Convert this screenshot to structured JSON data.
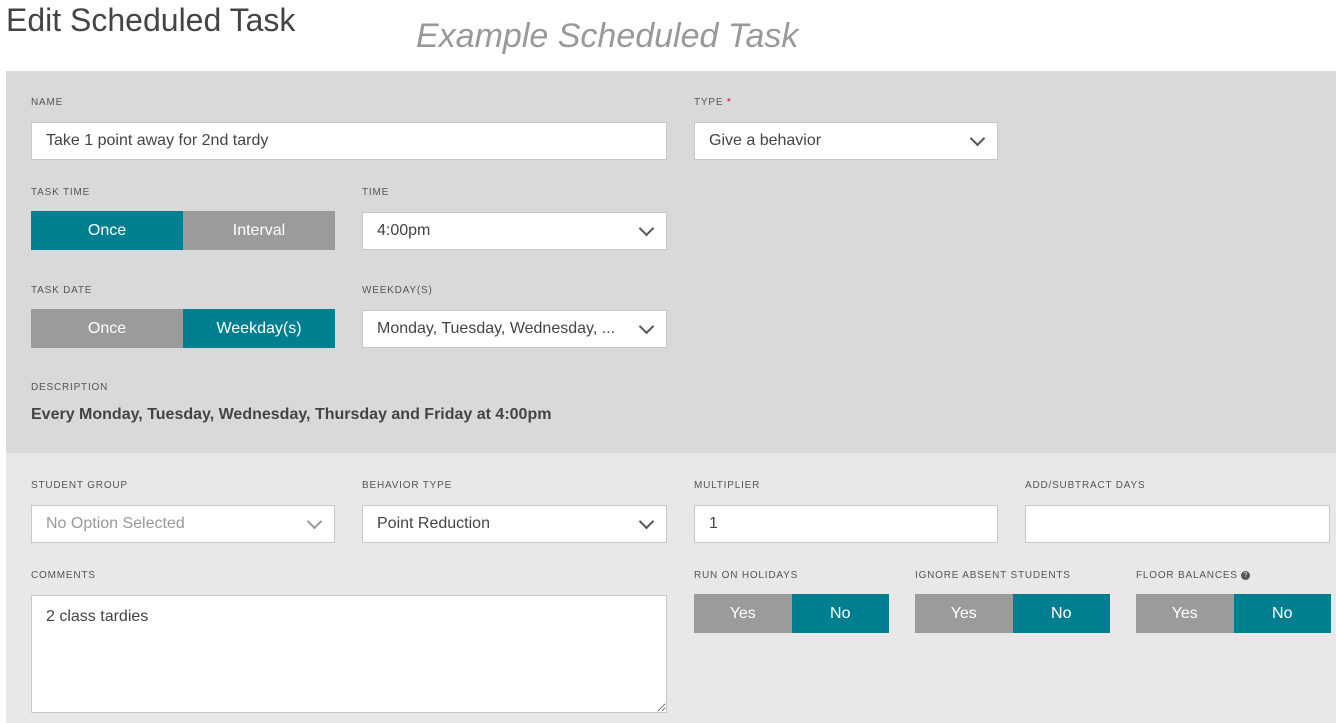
{
  "header": {
    "title": "Edit Scheduled Task",
    "subtitle": "Example Scheduled Task"
  },
  "colors": {
    "accent": "#007f91",
    "inactive": "#9b9b9b",
    "panel_top": "#d9d9d9",
    "panel_bottom": "#e8e8e8"
  },
  "name": {
    "label": "NAME",
    "value": "Take 1 point away for 2nd tardy"
  },
  "type": {
    "label": "TYPE",
    "required": "*",
    "value": "Give a behavior"
  },
  "task_time": {
    "label": "TASK TIME",
    "options": [
      "Once",
      "Interval"
    ],
    "selected": "Once"
  },
  "time": {
    "label": "TIME",
    "value": "4:00pm"
  },
  "task_date": {
    "label": "TASK DATE",
    "options": [
      "Once",
      "Weekday(s)"
    ],
    "selected": "Weekday(s)"
  },
  "weekdays": {
    "label": "WEEKDAY(S)",
    "value": "Monday, Tuesday, Wednesday, ..."
  },
  "description": {
    "label": "DESCRIPTION",
    "value": "Every Monday, Tuesday, Wednesday, Thursday and Friday at 4:00pm"
  },
  "student_group": {
    "label": "STUDENT GROUP",
    "placeholder": "No Option Selected"
  },
  "behavior_type": {
    "label": "BEHAVIOR TYPE",
    "value": "Point Reduction"
  },
  "multiplier": {
    "label": "MULTIPLIER",
    "value": "1"
  },
  "add_subtract_days": {
    "label": "ADD/SUBTRACT DAYS",
    "value": ""
  },
  "comments": {
    "label": "COMMENTS",
    "value": "2 class tardies"
  },
  "run_on_holidays": {
    "label": "RUN ON HOLIDAYS",
    "options": [
      "Yes",
      "No"
    ],
    "selected": "No"
  },
  "ignore_absent": {
    "label": "IGNORE ABSENT STUDENTS",
    "options": [
      "Yes",
      "No"
    ],
    "selected": "No"
  },
  "floor_balances": {
    "label": "FLOOR BALANCES",
    "help_icon": "question-circle-icon",
    "options": [
      "Yes",
      "No"
    ],
    "selected": "No"
  }
}
